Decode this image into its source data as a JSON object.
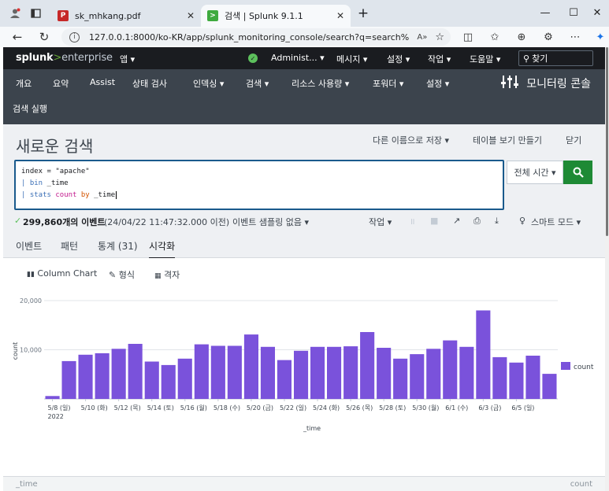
{
  "browser": {
    "tabs": [
      {
        "title": "sk_mhkang.pdf",
        "active": false
      },
      {
        "title": "검색 | Splunk 9.1.1",
        "active": true
      }
    ],
    "url": "127.0.0.1:8000/ko-KR/app/splunk_monitoring_console/search?q=search%20in...",
    "new_tab": "+",
    "minimize": "—",
    "maximize": "☐",
    "close": "✕"
  },
  "splunk_bar": {
    "logo_a": "splunk",
    "logo_gt": ">",
    "logo_b": "enterprise",
    "apps": "앱 ▾",
    "user": "Administ... ▾",
    "messages": "메시지 ▾",
    "settings": "설정 ▾",
    "activity": "작업 ▾",
    "help": "도움말 ▾",
    "find_placeholder": "찾기"
  },
  "app_nav": {
    "items": [
      "개요",
      "요약",
      "Assist",
      "상태 검사",
      "인덱싱 ▾",
      "검색 ▾",
      "리소스 사용량 ▾",
      "포워더 ▾",
      "설정 ▾"
    ],
    "run_search": "검색 실행",
    "app_title": "모니터링 콘솔"
  },
  "page": {
    "title": "새로운 검색",
    "save_as": "다른 이름으로 저장 ▾",
    "create_table": "테이블 보기 만들기",
    "close": "닫기",
    "query": {
      "line1_a": "index = ",
      "line1_b": "\"apache\"",
      "line2_pipe": "| ",
      "line2_cmd": "bin",
      "line2_arg": " _time",
      "line3_pipe": "| ",
      "line3_cmd": "stats",
      "line3_fn": " count",
      "line3_by": " by",
      "line3_arg": " _time"
    },
    "time_range": "전체 시간 ▾",
    "status": {
      "check": "✓",
      "count": "299,860개의 이벤트",
      "detail": "(24/04/22 11:47:32.000 이전)",
      "sampling": "이벤트 샘플링 없음 ▾",
      "job": "작업 ▾",
      "mode": "스마트 모드 ▾"
    },
    "tabs": [
      "이벤트",
      "패턴",
      "통계 (31)",
      "시각화"
    ],
    "viz_tools": {
      "chart_type": "Column Chart",
      "format": "형식",
      "trellis": "격자"
    },
    "bottom": {
      "left": "_time",
      "right": "count"
    }
  },
  "chart_data": {
    "type": "bar",
    "xlabel": "_time",
    "ylabel": "count",
    "ylim": [
      0,
      20000
    ],
    "yticks": [
      "20,000",
      "10,000"
    ],
    "year_label": "2022",
    "legend": "count",
    "legend_color": "#7a52db",
    "tick_labels": [
      "5/8 (일)",
      "5/10 (화)",
      "5/12 (목)",
      "5/14 (토)",
      "5/16 (월)",
      "5/18 (수)",
      "5/20 (금)",
      "5/22 (일)",
      "5/24 (화)",
      "5/26 (목)",
      "5/28 (토)",
      "5/30 (월)",
      "6/1 (수)",
      "6/3 (금)",
      "6/5 (일)"
    ],
    "categories": [
      "5/8",
      "5/9",
      "5/10",
      "5/11",
      "5/12",
      "5/13",
      "5/14",
      "5/15",
      "5/16",
      "5/17",
      "5/18",
      "5/19",
      "5/20",
      "5/21",
      "5/22",
      "5/23",
      "5/24",
      "5/25",
      "5/26",
      "5/27",
      "5/28",
      "5/29",
      "5/30",
      "5/31",
      "6/1",
      "6/2",
      "6/3",
      "6/4",
      "6/5",
      "6/6",
      "6/7"
    ],
    "values": [
      600,
      7700,
      9000,
      9300,
      10200,
      11200,
      7600,
      6900,
      8200,
      11100,
      10800,
      10800,
      13100,
      10600,
      7900,
      9800,
      10600,
      10600,
      10700,
      13600,
      10400,
      8200,
      9100,
      10200,
      11900,
      10600,
      18000,
      8500,
      7400,
      8800,
      5100
    ]
  }
}
